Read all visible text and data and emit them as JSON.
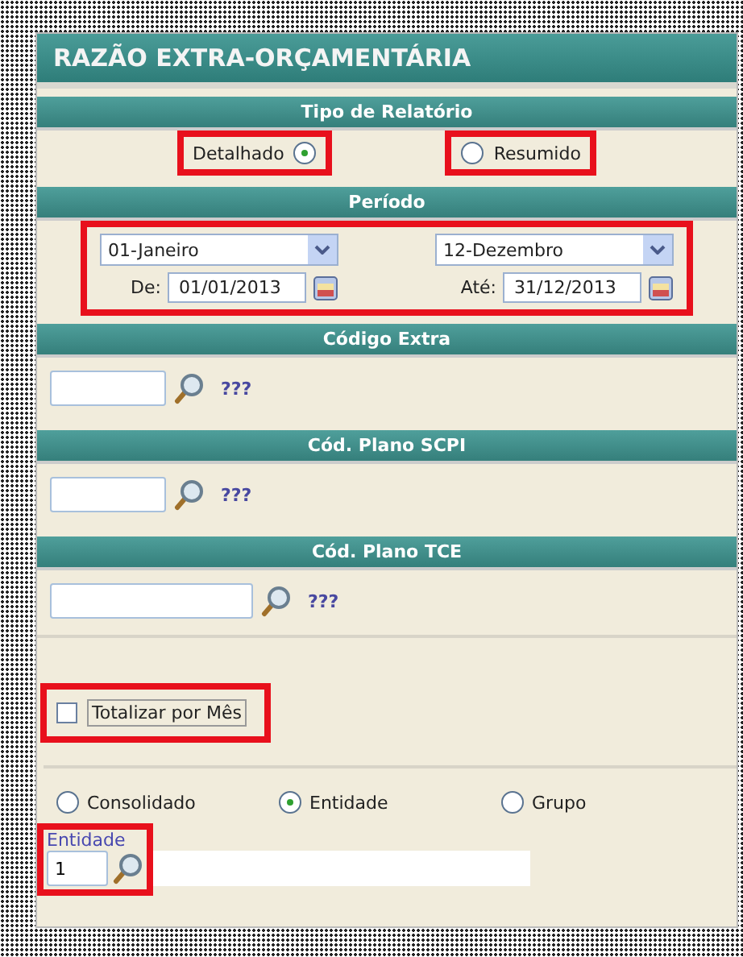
{
  "title": "RAZÃO EXTRA-ORÇAMENTÁRIA",
  "report_type": {
    "header": "Tipo de Relatório",
    "options": [
      {
        "label": "Detalhado",
        "selected": true
      },
      {
        "label": "Resumido",
        "selected": false
      }
    ]
  },
  "period": {
    "header": "Período",
    "start_month": "01-Janeiro",
    "end_month": "12-Dezembro",
    "from_label": "De:",
    "from_value": "01/01/2013",
    "to_label": "Até:",
    "to_value": "31/12/2013"
  },
  "lookups": [
    {
      "header": "Código Extra",
      "description": "???"
    },
    {
      "header": "Cód. Plano SCPI",
      "description": "???"
    },
    {
      "header": "Cód. Plano TCE",
      "description": "???"
    }
  ],
  "totalize": {
    "label": "Totalizar por Mês",
    "checked": false
  },
  "scope": [
    {
      "label": "Consolidado",
      "selected": false
    },
    {
      "label": "Entidade",
      "selected": true
    },
    {
      "label": "Grupo",
      "selected": false
    }
  ],
  "entity": {
    "label": "Entidade",
    "value": "1"
  }
}
